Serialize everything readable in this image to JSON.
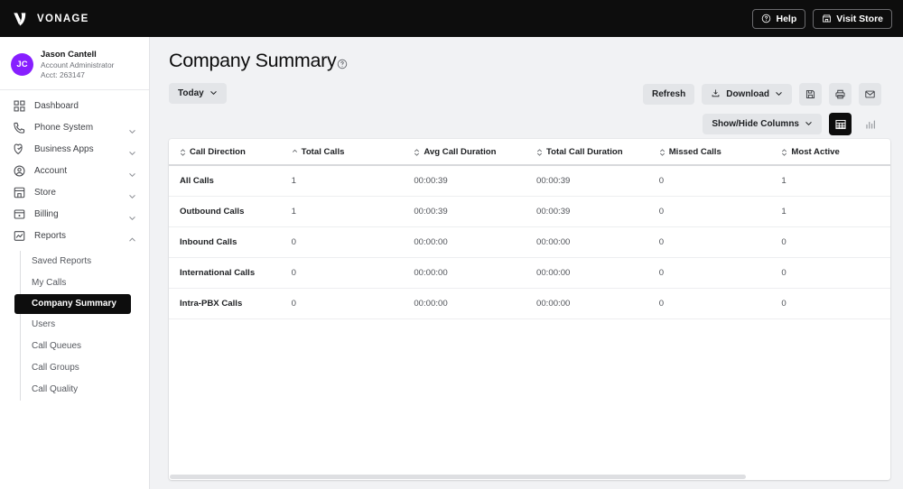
{
  "topbar": {
    "brand": "VONAGE",
    "brand_icon": "vonage-v-logo",
    "help_label": "Help",
    "help_icon": "question-circle-icon",
    "store_label": "Visit Store",
    "store_icon": "storefront-icon"
  },
  "sidebar": {
    "profile": {
      "initials": "JC",
      "name": "Jason Cantell",
      "role": "Account Administrator",
      "account": "Acct: 263147",
      "avatar_color": "#871fff"
    },
    "items": [
      {
        "label": "Dashboard",
        "icon": "grid-icon",
        "expandable": false
      },
      {
        "label": "Phone System",
        "icon": "phone-icon",
        "expandable": true
      },
      {
        "label": "Business Apps",
        "icon": "apps-heart-icon",
        "expandable": true
      },
      {
        "label": "Account",
        "icon": "user-circle-icon",
        "expandable": true
      },
      {
        "label": "Store",
        "icon": "storefront-icon",
        "expandable": true
      },
      {
        "label": "Billing",
        "icon": "wallet-icon",
        "expandable": true
      },
      {
        "label": "Reports",
        "icon": "report-chart-icon",
        "expandable": true,
        "expanded": true
      }
    ],
    "subitems": [
      {
        "label": "Saved Reports",
        "active": false
      },
      {
        "label": "My Calls",
        "active": false
      },
      {
        "label": "Company Summary",
        "active": true
      },
      {
        "label": "Users",
        "active": false
      },
      {
        "label": "Call Queues",
        "active": false
      },
      {
        "label": "Call Groups",
        "active": false
      },
      {
        "label": "Call Quality",
        "active": false
      }
    ]
  },
  "main": {
    "title": "Company Summary",
    "help_icon": "question-circle-icon",
    "date_filter": "Today",
    "refresh_label": "Refresh",
    "download_label": "Download",
    "download_icon": "download-icon",
    "save_icon": "floppy-save-icon",
    "print_icon": "printer-icon",
    "email_icon": "envelope-icon",
    "columns_label": "Show/Hide Columns",
    "table_view_icon": "table-grid-icon",
    "chart_view_icon": "bar-chart-icon",
    "active_view": "table"
  },
  "table": {
    "columns": [
      {
        "label": "Call Direction",
        "sort": "none"
      },
      {
        "label": "Total Calls",
        "sort": "asc"
      },
      {
        "label": "Avg Call Duration",
        "sort": "none"
      },
      {
        "label": "Total Call Duration",
        "sort": "none"
      },
      {
        "label": "Missed Calls",
        "sort": "none"
      },
      {
        "label": "Most Active",
        "sort": "none"
      }
    ],
    "rows": [
      {
        "direction": "All Calls",
        "total_calls": "1",
        "avg_duration": "00:00:39",
        "total_duration": "00:00:39",
        "missed": "0",
        "most_active": "1"
      },
      {
        "direction": "Outbound Calls",
        "total_calls": "1",
        "avg_duration": "00:00:39",
        "total_duration": "00:00:39",
        "missed": "0",
        "most_active": "1"
      },
      {
        "direction": "Inbound Calls",
        "total_calls": "0",
        "avg_duration": "00:00:00",
        "total_duration": "00:00:00",
        "missed": "0",
        "most_active": "0"
      },
      {
        "direction": "International Calls",
        "total_calls": "0",
        "avg_duration": "00:00:00",
        "total_duration": "00:00:00",
        "missed": "0",
        "most_active": "0"
      },
      {
        "direction": "Intra-PBX Calls",
        "total_calls": "0",
        "avg_duration": "00:00:00",
        "total_duration": "00:00:00",
        "missed": "0",
        "most_active": "0"
      }
    ]
  }
}
